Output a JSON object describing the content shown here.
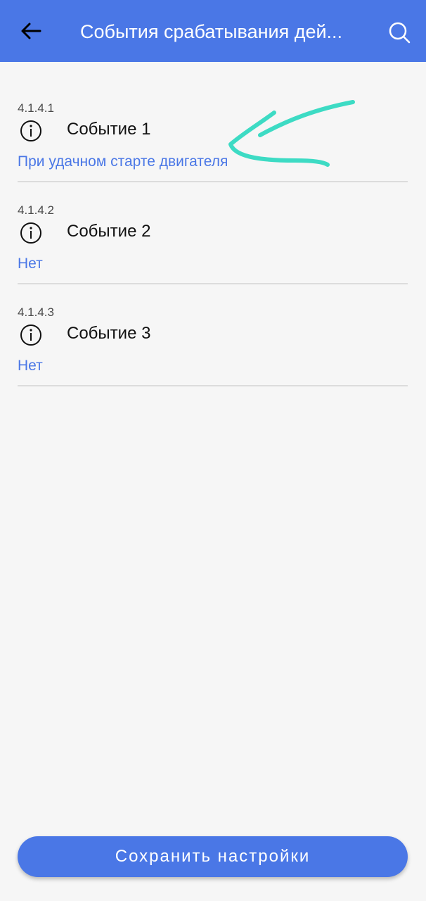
{
  "header": {
    "title": "События срабатывания дей...",
    "back_icon": "arrow-left-icon",
    "search_icon": "search-icon"
  },
  "events": [
    {
      "code": "4.1.4.1",
      "name": "Событие 1",
      "value": "При удачном старте двигателя"
    },
    {
      "code": "4.1.4.2",
      "name": "Событие 2",
      "value": "Нет"
    },
    {
      "code": "4.1.4.3",
      "name": "Событие 3",
      "value": "Нет"
    }
  ],
  "footer": {
    "save_label": "Сохранить настройки"
  },
  "colors": {
    "accent": "#4a77e6",
    "background": "#f6f6f6",
    "annotation": "#3ddbc4"
  }
}
